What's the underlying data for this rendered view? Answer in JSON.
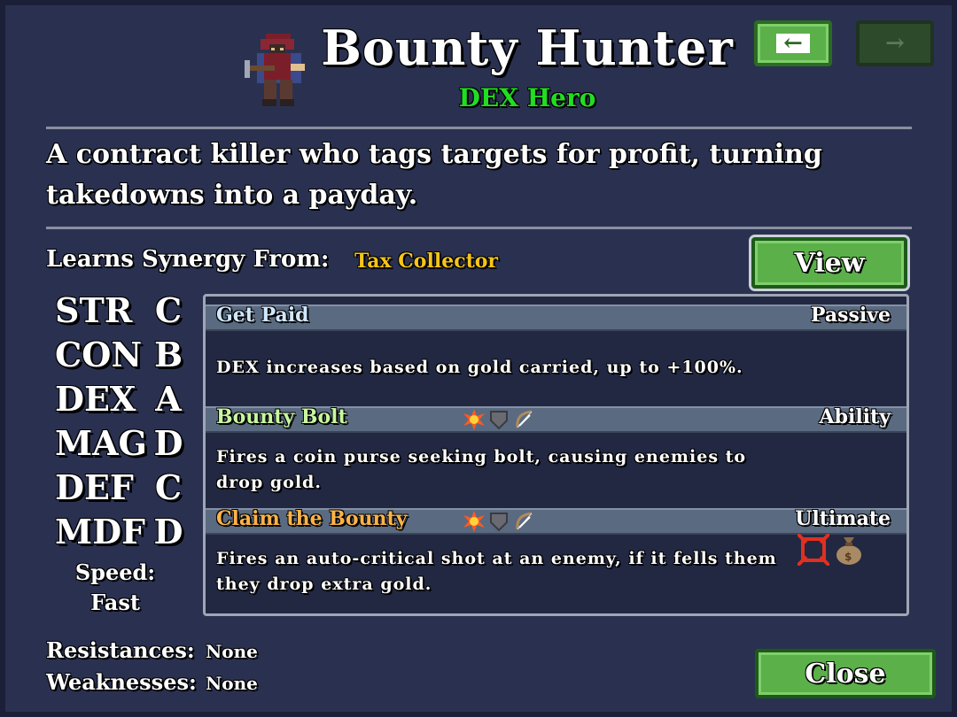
{
  "hero": {
    "name": "Bounty Hunter",
    "class": "DEX Hero",
    "description": "A contract killer who tags targets for profit, turning takedowns into a payday."
  },
  "nav": {
    "prev_icon": "arrow-left-icon",
    "next_icon": "arrow-right-icon",
    "prev_enabled": true,
    "next_enabled": false
  },
  "synergy": {
    "label": "Learns Synergy From:",
    "value": "Tax Collector",
    "view_label": "View"
  },
  "stats": [
    {
      "name": "STR",
      "grade": "C"
    },
    {
      "name": "CON",
      "grade": "B"
    },
    {
      "name": "DEX",
      "grade": "A"
    },
    {
      "name": "MAG",
      "grade": "D"
    },
    {
      "name": "DEF",
      "grade": "C"
    },
    {
      "name": "MDF",
      "grade": "D"
    }
  ],
  "speed": {
    "label": "Speed:",
    "value": "Fast"
  },
  "skills": [
    {
      "name": "Get Paid",
      "type": "Passive",
      "name_color": "#cfe8ff",
      "description": "DEX increases based on gold carried, up to +100%."
    },
    {
      "name": "Bounty Bolt",
      "type": "Ability",
      "name_color": "#c8f7a0",
      "tags": [
        "fire-burst-icon",
        "shield-icon",
        "bow-icon"
      ],
      "description": "Fires a coin purse seeking bolt, causing enemies to drop gold."
    },
    {
      "name": "Claim the Bounty",
      "type": "Ultimate",
      "name_color": "#ffb347",
      "tags": [
        "fire-burst-icon",
        "shield-icon",
        "bow-icon"
      ],
      "extra_icons": [
        "crosshair-icon",
        "money-bag-icon"
      ],
      "description": "Fires an auto-critical shot at an enemy, if it fells them they drop extra gold."
    }
  ],
  "resistances": {
    "label": "Resistances:",
    "value": "None"
  },
  "weaknesses": {
    "label": "Weaknesses:",
    "value": "None"
  },
  "close_label": "Close",
  "colors": {
    "background": "#2a3150",
    "hero_class": "#22dd22",
    "synergy_value": "#f5c518",
    "button_green": "#5bb04a"
  }
}
